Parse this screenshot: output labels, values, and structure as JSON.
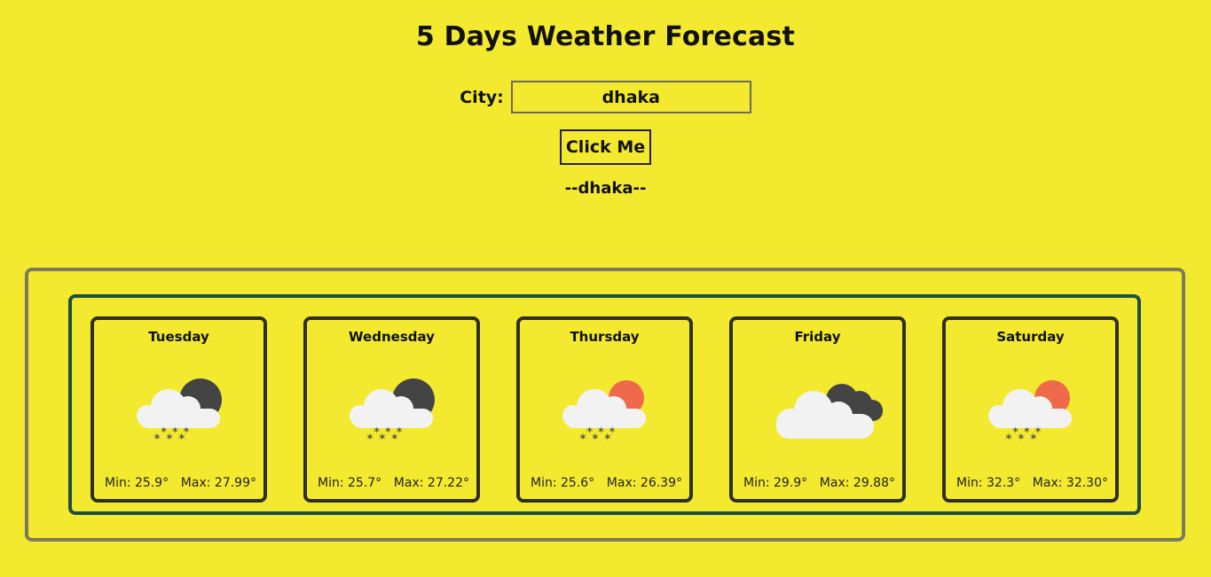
{
  "header": {
    "title": "5 Days Weather Forecast"
  },
  "search": {
    "label": "City:",
    "value": "dhaka",
    "button_label": "Click Me",
    "result_city": "--dhaka--"
  },
  "forecast": [
    {
      "day": "Tuesday",
      "min": "Min: 25.9°",
      "max": "Max: 27.99°",
      "icon": "rain-cloud-moon-icon"
    },
    {
      "day": "Wednesday",
      "min": "Min: 25.7°",
      "max": "Max: 27.22°",
      "icon": "rain-cloud-moon-icon"
    },
    {
      "day": "Thursday",
      "min": "Min: 25.6°",
      "max": "Max: 26.39°",
      "icon": "rain-cloud-sun-icon"
    },
    {
      "day": "Friday",
      "min": "Min: 29.9°",
      "max": "Max: 29.88°",
      "icon": "dark-clouds-icon"
    },
    {
      "day": "Saturday",
      "min": "Min: 32.3°",
      "max": "Max: 32.30°",
      "icon": "rain-cloud-sun-icon"
    }
  ],
  "colors": {
    "background": "#f3e92e",
    "outer_border": "#7c7a5c",
    "inner_border": "#1f4f44",
    "card_border": "#2f2f2a",
    "sun": "#ee6a4b",
    "dark_cloud": "#4a4a4a",
    "white_cloud": "#f2f2f2"
  }
}
